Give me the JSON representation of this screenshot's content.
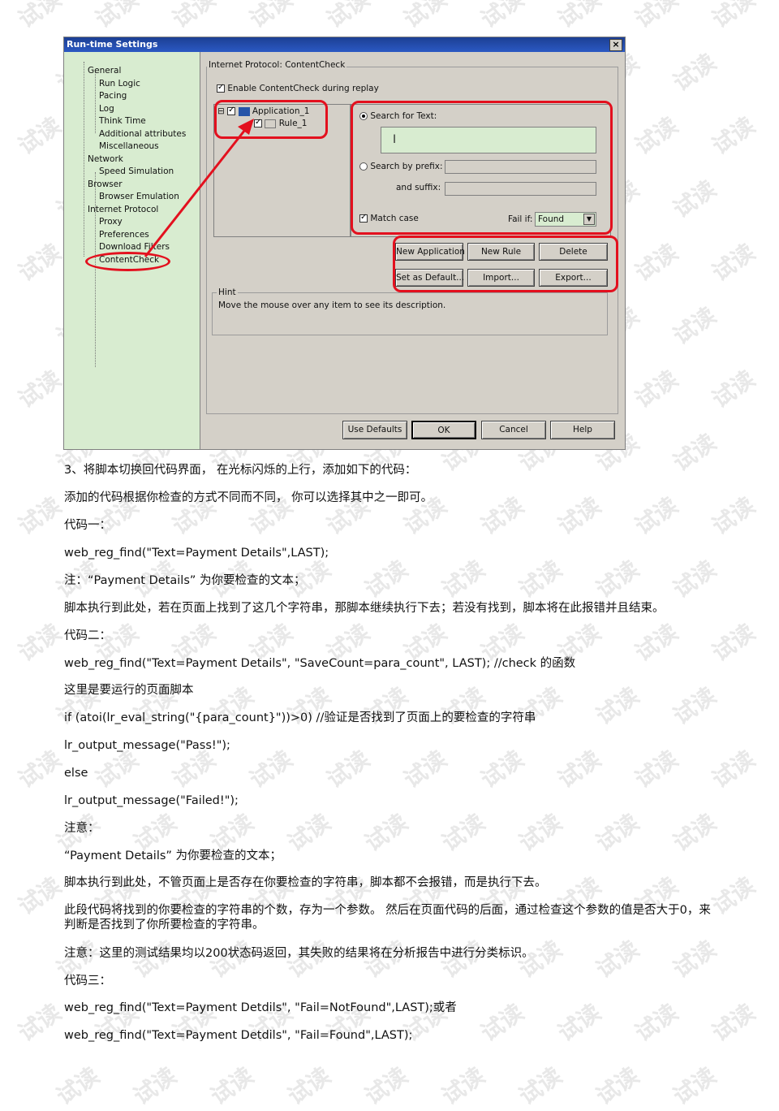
{
  "dialog": {
    "title": "Run-time Settings",
    "close_glyph": "×",
    "tree": {
      "items": [
        {
          "label": "General",
          "level": 0
        },
        {
          "label": "Run Logic",
          "level": 1
        },
        {
          "label": "Pacing",
          "level": 1
        },
        {
          "label": "Log",
          "level": 1
        },
        {
          "label": "Think Time",
          "level": 1
        },
        {
          "label": "Additional attributes",
          "level": 1
        },
        {
          "label": "Miscellaneous",
          "level": 1
        },
        {
          "label": "Network",
          "level": 0
        },
        {
          "label": "Speed Simulation",
          "level": 1
        },
        {
          "label": "Browser",
          "level": 0
        },
        {
          "label": "Browser Emulation",
          "level": 1
        },
        {
          "label": "Internet Protocol",
          "level": 0
        },
        {
          "label": "Proxy",
          "level": 1
        },
        {
          "label": "Preferences",
          "level": 1
        },
        {
          "label": "Download Filters",
          "level": 1
        },
        {
          "label": "ContentCheck",
          "level": 1
        }
      ]
    },
    "group_title": "Internet Protocol: ContentCheck",
    "enable_label": "Enable ContentCheck during replay",
    "app_tree": {
      "application": "Application_1",
      "rule": "Rule_1",
      "expander": "⊟"
    },
    "search_text_label": "Search for Text:",
    "search_prefix_label": "Search by prefix:",
    "suffix_label": "and suffix:",
    "match_case_label": "Match case",
    "fail_if_label": "Fail if:",
    "fail_if_value": "Found",
    "buttons": {
      "new_application": "New Application",
      "new_rule": "New Rule",
      "delete": "Delete",
      "set_default": "Set as Default...",
      "import": "Import...",
      "export": "Export..."
    },
    "hint_title": "Hint",
    "hint_text": "Move the mouse over any item to see its description.",
    "footer": {
      "use_defaults": "Use Defaults",
      "ok": "OK",
      "cancel": "Cancel",
      "help": "Help"
    }
  },
  "document": {
    "p1": "3、将脚本切换回代码界面， 在光标闪烁的上行，添加如下的代码：",
    "p2": "添加的代码根据你检查的方式不同而不同， 你可以选择其中之一即可。",
    "p3": "代码一：",
    "p4": "web_reg_find(\"Text=Payment Details\",LAST);",
    "p5": "注：“Payment Details” 为你要检查的文本；",
    "p6": "脚本执行到此处，若在页面上找到了这几个字符串，那脚本继续执行下去；若没有找到，脚本将在此报错并且结束。",
    "p7": "代码二：",
    "p8": "web_reg_find(\"Text=Payment Details\", \"SaveCount=para_count\", LAST); //check 的函数",
    "p9": "这里是要运行的页面脚本",
    "p10": "if (atoi(lr_eval_string(\"{para_count}\"))>0) //验证是否找到了页面上的要检查的字符串",
    "p11": "lr_output_message(\"Pass!\");",
    "p12": "else",
    "p13": "lr_output_message(\"Failed!\");",
    "p14": "注意：",
    "p15": "“Payment Details” 为你要检查的文本；",
    "p16": "脚本执行到此处，不管页面上是否存在你要检查的字符串，脚本都不会报错，而是执行下去。",
    "p17": "此段代码将找到的你要检查的字符串的个数，存为一个参数。 然后在页面代码的后面，通过检查这个参数的值是否大于0，来判断是否找到了你所要检查的字符串。",
    "p18": "注意：这里的测试结果均以200状态码返回，其失败的结果将在分析报告中进行分类标识。",
    "p19": "代码三：",
    "p20": "web_reg_find(\"Text=Payment Detdils\", \"Fail=NotFound\",LAST);或者",
    "p21": "web_reg_find(\"Text=Payment Detdils\", \"Fail=Found\",LAST);"
  },
  "watermark": "试读",
  "colors": {
    "highlight": "#e3101e",
    "tree_bg": "#d8ecd0",
    "dialog_bg": "#d4d0c8"
  }
}
